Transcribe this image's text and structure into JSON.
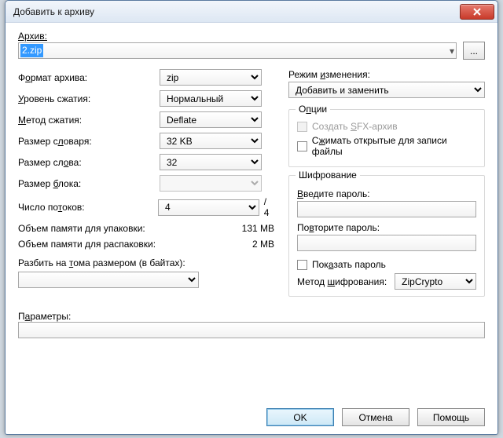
{
  "window": {
    "title": "Добавить к архиву"
  },
  "archive": {
    "label": "Архив:",
    "value": "2.zip",
    "browse": "..."
  },
  "left": {
    "format": {
      "label_pre": "Ф",
      "label_u": "о",
      "label_post": "рмат архива:",
      "value": "zip"
    },
    "level": {
      "label_pre": "",
      "label_u": "У",
      "label_post": "ровень сжатия:",
      "value": "Нормальный"
    },
    "method": {
      "label_pre": "",
      "label_u": "М",
      "label_post": "етод сжатия:",
      "value": "Deflate"
    },
    "dict": {
      "label_pre": "Размер с",
      "label_u": "л",
      "label_post": "оваря:",
      "value": "32 KB"
    },
    "word": {
      "label_pre": "Размер сл",
      "label_u": "о",
      "label_post": "ва:",
      "value": "32"
    },
    "block": {
      "label_pre": "Размер ",
      "label_u": "б",
      "label_post": "лока:",
      "value": ""
    },
    "threads": {
      "label_pre": "Число по",
      "label_u": "т",
      "label_post": "оков:",
      "value": "4",
      "suffix": "/ 4"
    },
    "mem_pack": {
      "label": "Объем памяти для упаковки:",
      "value": "131 MB"
    },
    "mem_unpack": {
      "label": "Объем памяти для распаковки:",
      "value": "2 MB"
    },
    "split": {
      "label_pre": "Разбить на ",
      "label_u": "т",
      "label_post": "ома размером (в байтах):"
    }
  },
  "right": {
    "update_mode": {
      "label_pre": "Режим ",
      "label_u": "и",
      "label_post": "зменения:",
      "value": "Добавить и заменить"
    },
    "options": {
      "legend_pre": "О",
      "legend_u": "п",
      "legend_post": "ции",
      "sfx": {
        "label_pre": "Создать ",
        "label_u": "S",
        "label_post": "FX-архив"
      },
      "shared": {
        "label_pre": "С",
        "label_u": "ж",
        "label_post": "имать открытые для записи файлы"
      }
    },
    "encryption": {
      "legend": "Шифрование",
      "pwd": {
        "label_pre": "",
        "label_u": "В",
        "label_post": "ведите пароль:"
      },
      "pwd2": {
        "label_pre": "По",
        "label_u": "в",
        "label_post": "торите пароль:"
      },
      "show": {
        "label_pre": "Пок",
        "label_u": "а",
        "label_post": "зать пароль"
      },
      "method": {
        "label_pre": "Метод ",
        "label_u": "ш",
        "label_post": "ифрования:",
        "value": "ZipCrypto"
      }
    }
  },
  "params": {
    "label_pre": "П",
    "label_u": "а",
    "label_post": "раметры:"
  },
  "buttons": {
    "ok": "OK",
    "cancel": "Отмена",
    "help": "Помощь"
  }
}
